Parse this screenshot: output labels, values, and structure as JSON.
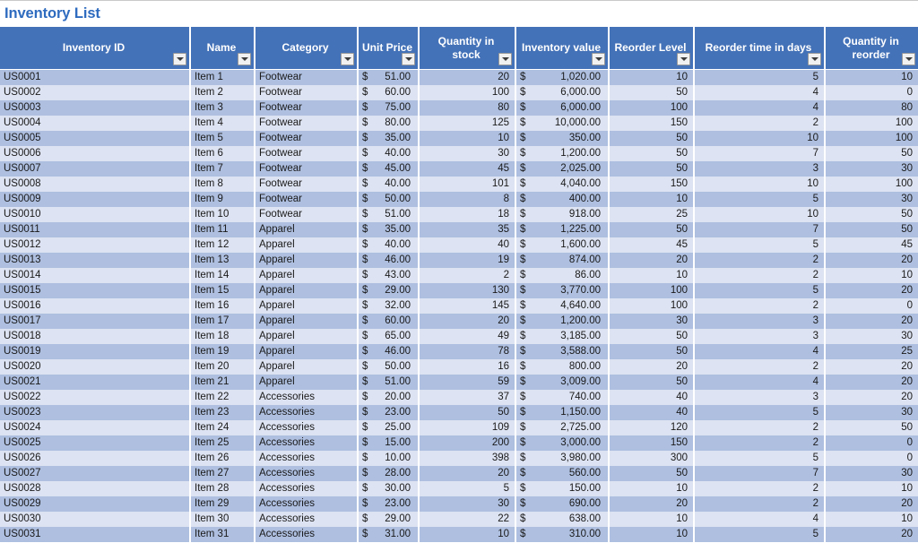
{
  "document": {
    "title": "Inventory List"
  },
  "table": {
    "filter_icon": "filter-dropdown-icon",
    "currency_symbol": "$",
    "columns": [
      {
        "label": "Inventory ID",
        "key": "inventory_id",
        "align": "left"
      },
      {
        "label": "Name",
        "key": "name",
        "align": "left"
      },
      {
        "label": "Category",
        "key": "category",
        "align": "left"
      },
      {
        "label": "Unit Price",
        "key": "unit_price",
        "align": "money"
      },
      {
        "label": "Quantity in stock",
        "key": "quantity_in_stock",
        "align": "right"
      },
      {
        "label": "Inventory value",
        "key": "inventory_value",
        "align": "money"
      },
      {
        "label": "Reorder Level",
        "key": "reorder_level",
        "align": "right"
      },
      {
        "label": "Reorder time in days",
        "key": "reorder_time_days",
        "align": "right"
      },
      {
        "label": "Quantity in reorder",
        "key": "quantity_in_reorder",
        "align": "right"
      }
    ],
    "rows": [
      {
        "inventory_id": "US0001",
        "name": "Item 1",
        "category": "Footwear",
        "unit_price": "51.00",
        "quantity_in_stock": "20",
        "inventory_value": "1,020.00",
        "reorder_level": "10",
        "reorder_time_days": "5",
        "quantity_in_reorder": "10"
      },
      {
        "inventory_id": "US0002",
        "name": "Item 2",
        "category": "Footwear",
        "unit_price": "60.00",
        "quantity_in_stock": "100",
        "inventory_value": "6,000.00",
        "reorder_level": "50",
        "reorder_time_days": "4",
        "quantity_in_reorder": "0"
      },
      {
        "inventory_id": "US0003",
        "name": "Item 3",
        "category": "Footwear",
        "unit_price": "75.00",
        "quantity_in_stock": "80",
        "inventory_value": "6,000.00",
        "reorder_level": "100",
        "reorder_time_days": "4",
        "quantity_in_reorder": "80"
      },
      {
        "inventory_id": "US0004",
        "name": "Item 4",
        "category": "Footwear",
        "unit_price": "80.00",
        "quantity_in_stock": "125",
        "inventory_value": "10,000.00",
        "reorder_level": "150",
        "reorder_time_days": "2",
        "quantity_in_reorder": "100"
      },
      {
        "inventory_id": "US0005",
        "name": "Item 5",
        "category": "Footwear",
        "unit_price": "35.00",
        "quantity_in_stock": "10",
        "inventory_value": "350.00",
        "reorder_level": "50",
        "reorder_time_days": "10",
        "quantity_in_reorder": "100"
      },
      {
        "inventory_id": "US0006",
        "name": "Item 6",
        "category": "Footwear",
        "unit_price": "40.00",
        "quantity_in_stock": "30",
        "inventory_value": "1,200.00",
        "reorder_level": "50",
        "reorder_time_days": "7",
        "quantity_in_reorder": "50"
      },
      {
        "inventory_id": "US0007",
        "name": "Item 7",
        "category": "Footwear",
        "unit_price": "45.00",
        "quantity_in_stock": "45",
        "inventory_value": "2,025.00",
        "reorder_level": "50",
        "reorder_time_days": "3",
        "quantity_in_reorder": "30"
      },
      {
        "inventory_id": "US0008",
        "name": "Item 8",
        "category": "Footwear",
        "unit_price": "40.00",
        "quantity_in_stock": "101",
        "inventory_value": "4,040.00",
        "reorder_level": "150",
        "reorder_time_days": "10",
        "quantity_in_reorder": "100"
      },
      {
        "inventory_id": "US0009",
        "name": "Item 9",
        "category": "Footwear",
        "unit_price": "50.00",
        "quantity_in_stock": "8",
        "inventory_value": "400.00",
        "reorder_level": "10",
        "reorder_time_days": "5",
        "quantity_in_reorder": "30"
      },
      {
        "inventory_id": "US0010",
        "name": "Item 10",
        "category": "Footwear",
        "unit_price": "51.00",
        "quantity_in_stock": "18",
        "inventory_value": "918.00",
        "reorder_level": "25",
        "reorder_time_days": "10",
        "quantity_in_reorder": "50"
      },
      {
        "inventory_id": "US0011",
        "name": "Item 11",
        "category": "Apparel",
        "unit_price": "35.00",
        "quantity_in_stock": "35",
        "inventory_value": "1,225.00",
        "reorder_level": "50",
        "reorder_time_days": "7",
        "quantity_in_reorder": "50"
      },
      {
        "inventory_id": "US0012",
        "name": "Item 12",
        "category": "Apparel",
        "unit_price": "40.00",
        "quantity_in_stock": "40",
        "inventory_value": "1,600.00",
        "reorder_level": "45",
        "reorder_time_days": "5",
        "quantity_in_reorder": "45"
      },
      {
        "inventory_id": "US0013",
        "name": "Item 13",
        "category": "Apparel",
        "unit_price": "46.00",
        "quantity_in_stock": "19",
        "inventory_value": "874.00",
        "reorder_level": "20",
        "reorder_time_days": "2",
        "quantity_in_reorder": "20"
      },
      {
        "inventory_id": "US0014",
        "name": "Item 14",
        "category": "Apparel",
        "unit_price": "43.00",
        "quantity_in_stock": "2",
        "inventory_value": "86.00",
        "reorder_level": "10",
        "reorder_time_days": "2",
        "quantity_in_reorder": "10"
      },
      {
        "inventory_id": "US0015",
        "name": "Item 15",
        "category": "Apparel",
        "unit_price": "29.00",
        "quantity_in_stock": "130",
        "inventory_value": "3,770.00",
        "reorder_level": "100",
        "reorder_time_days": "5",
        "quantity_in_reorder": "20"
      },
      {
        "inventory_id": "US0016",
        "name": "Item 16",
        "category": "Apparel",
        "unit_price": "32.00",
        "quantity_in_stock": "145",
        "inventory_value": "4,640.00",
        "reorder_level": "100",
        "reorder_time_days": "2",
        "quantity_in_reorder": "0"
      },
      {
        "inventory_id": "US0017",
        "name": "Item 17",
        "category": "Apparel",
        "unit_price": "60.00",
        "quantity_in_stock": "20",
        "inventory_value": "1,200.00",
        "reorder_level": "30",
        "reorder_time_days": "3",
        "quantity_in_reorder": "20"
      },
      {
        "inventory_id": "US0018",
        "name": "Item 18",
        "category": "Apparel",
        "unit_price": "65.00",
        "quantity_in_stock": "49",
        "inventory_value": "3,185.00",
        "reorder_level": "50",
        "reorder_time_days": "3",
        "quantity_in_reorder": "30"
      },
      {
        "inventory_id": "US0019",
        "name": "Item 19",
        "category": "Apparel",
        "unit_price": "46.00",
        "quantity_in_stock": "78",
        "inventory_value": "3,588.00",
        "reorder_level": "50",
        "reorder_time_days": "4",
        "quantity_in_reorder": "25"
      },
      {
        "inventory_id": "US0020",
        "name": "Item 20",
        "category": "Apparel",
        "unit_price": "50.00",
        "quantity_in_stock": "16",
        "inventory_value": "800.00",
        "reorder_level": "20",
        "reorder_time_days": "2",
        "quantity_in_reorder": "20"
      },
      {
        "inventory_id": "US0021",
        "name": "Item 21",
        "category": "Apparel",
        "unit_price": "51.00",
        "quantity_in_stock": "59",
        "inventory_value": "3,009.00",
        "reorder_level": "50",
        "reorder_time_days": "4",
        "quantity_in_reorder": "20"
      },
      {
        "inventory_id": "US0022",
        "name": "Item 22",
        "category": "Accessories",
        "unit_price": "20.00",
        "quantity_in_stock": "37",
        "inventory_value": "740.00",
        "reorder_level": "40",
        "reorder_time_days": "3",
        "quantity_in_reorder": "20"
      },
      {
        "inventory_id": "US0023",
        "name": "Item 23",
        "category": "Accessories",
        "unit_price": "23.00",
        "quantity_in_stock": "50",
        "inventory_value": "1,150.00",
        "reorder_level": "40",
        "reorder_time_days": "5",
        "quantity_in_reorder": "30"
      },
      {
        "inventory_id": "US0024",
        "name": "Item 24",
        "category": "Accessories",
        "unit_price": "25.00",
        "quantity_in_stock": "109",
        "inventory_value": "2,725.00",
        "reorder_level": "120",
        "reorder_time_days": "2",
        "quantity_in_reorder": "50"
      },
      {
        "inventory_id": "US0025",
        "name": "Item 25",
        "category": "Accessories",
        "unit_price": "15.00",
        "quantity_in_stock": "200",
        "inventory_value": "3,000.00",
        "reorder_level": "150",
        "reorder_time_days": "2",
        "quantity_in_reorder": "0"
      },
      {
        "inventory_id": "US0026",
        "name": "Item 26",
        "category": "Accessories",
        "unit_price": "10.00",
        "quantity_in_stock": "398",
        "inventory_value": "3,980.00",
        "reorder_level": "300",
        "reorder_time_days": "5",
        "quantity_in_reorder": "0"
      },
      {
        "inventory_id": "US0027",
        "name": "Item 27",
        "category": "Accessories",
        "unit_price": "28.00",
        "quantity_in_stock": "20",
        "inventory_value": "560.00",
        "reorder_level": "50",
        "reorder_time_days": "7",
        "quantity_in_reorder": "30"
      },
      {
        "inventory_id": "US0028",
        "name": "Item 28",
        "category": "Accessories",
        "unit_price": "30.00",
        "quantity_in_stock": "5",
        "inventory_value": "150.00",
        "reorder_level": "10",
        "reorder_time_days": "2",
        "quantity_in_reorder": "10"
      },
      {
        "inventory_id": "US0029",
        "name": "Item 29",
        "category": "Accessories",
        "unit_price": "23.00",
        "quantity_in_stock": "30",
        "inventory_value": "690.00",
        "reorder_level": "20",
        "reorder_time_days": "2",
        "quantity_in_reorder": "20"
      },
      {
        "inventory_id": "US0030",
        "name": "Item 30",
        "category": "Accessories",
        "unit_price": "29.00",
        "quantity_in_stock": "22",
        "inventory_value": "638.00",
        "reorder_level": "10",
        "reorder_time_days": "4",
        "quantity_in_reorder": "10"
      },
      {
        "inventory_id": "US0031",
        "name": "Item 31",
        "category": "Accessories",
        "unit_price": "31.00",
        "quantity_in_stock": "10",
        "inventory_value": "310.00",
        "reorder_level": "10",
        "reorder_time_days": "5",
        "quantity_in_reorder": "20"
      }
    ]
  },
  "colors": {
    "header_blue": "#4472b8",
    "title_blue": "#2e6bbf",
    "row_odd": "#aebfe0",
    "row_even": "#dde3f2"
  }
}
